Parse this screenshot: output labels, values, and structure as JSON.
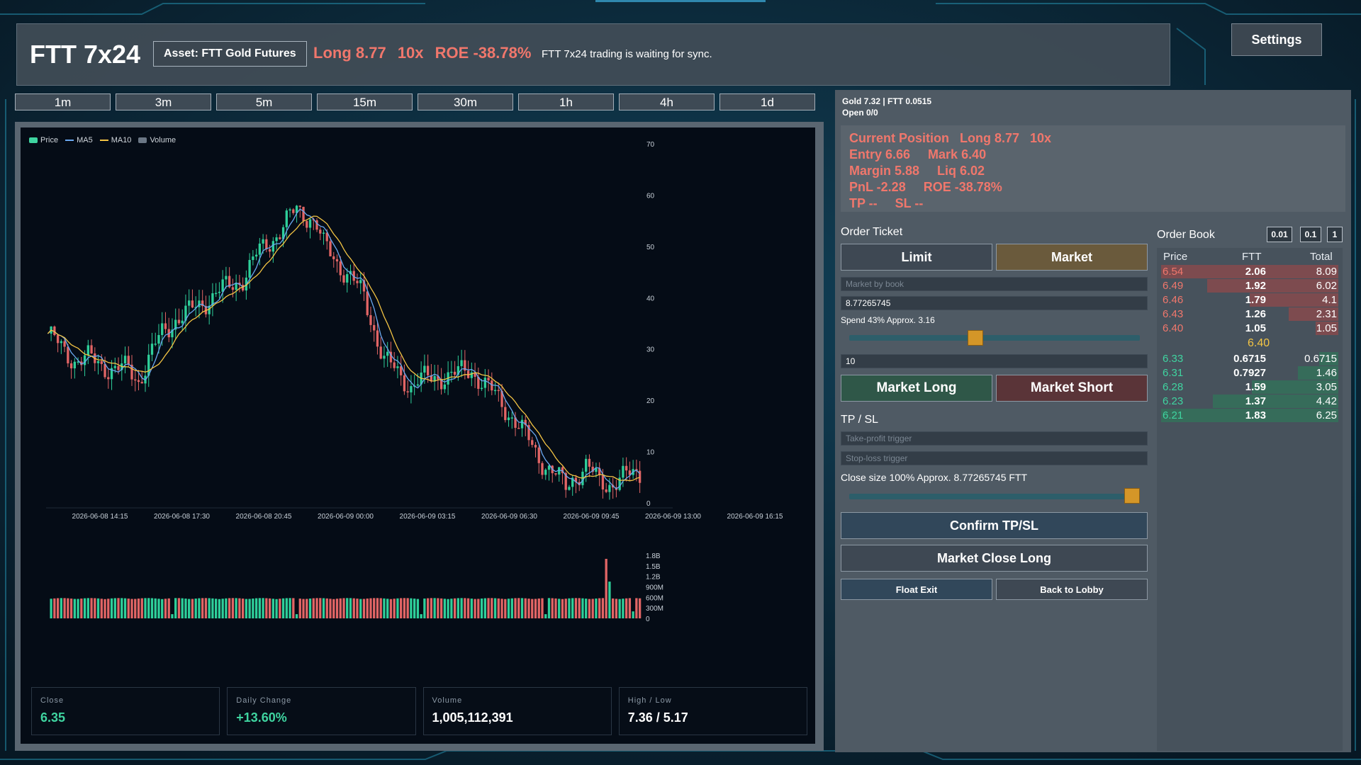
{
  "header": {
    "title": "FTT 7x24",
    "asset_label": "Asset: FTT Gold Futures",
    "pos_side": "Long 8.77",
    "pos_lev": "10x",
    "pos_roe": "ROE -38.78%",
    "sync_status": "FTT 7x24 trading is waiting for sync.",
    "settings_label": "Settings"
  },
  "timeframes": [
    "1m",
    "3m",
    "5m",
    "15m",
    "30m",
    "1h",
    "4h",
    "1d"
  ],
  "legend": [
    {
      "label": "Price",
      "color": "#3fd4a0",
      "kind": "box"
    },
    {
      "label": "MA5",
      "color": "#6aa8f0",
      "kind": "line"
    },
    {
      "label": "MA10",
      "color": "#f3c444",
      "kind": "line"
    },
    {
      "label": "Volume",
      "color": "#6b7785",
      "kind": "box"
    }
  ],
  "chart_data": {
    "type": "candlestick",
    "y_ticks": [
      0,
      10,
      20,
      30,
      40,
      50,
      60,
      70
    ],
    "ylim": [
      0,
      70
    ],
    "x_ticks": [
      "2026-06-08 14:15",
      "2026-06-08 17:30",
      "2026-06-08 20:45",
      "2026-06-09 00:00",
      "2026-06-09 03:15",
      "2026-06-09 06:30",
      "2026-06-09 09:45",
      "2026-06-09 13:00",
      "2026-06-09 16:15"
    ],
    "close_path": [
      [
        0,
        33
      ],
      [
        4,
        30
      ],
      [
        8,
        28
      ],
      [
        12,
        28
      ],
      [
        16,
        27
      ],
      [
        20,
        26
      ],
      [
        24,
        26
      ],
      [
        27,
        24
      ],
      [
        30,
        28
      ],
      [
        34,
        33
      ],
      [
        38,
        36
      ],
      [
        42,
        37
      ],
      [
        46,
        39
      ],
      [
        50,
        41
      ],
      [
        54,
        42
      ],
      [
        58,
        44
      ],
      [
        62,
        48
      ],
      [
        66,
        51
      ],
      [
        70,
        54
      ],
      [
        74,
        57
      ],
      [
        78,
        56
      ],
      [
        80,
        54
      ],
      [
        82,
        50
      ],
      [
        86,
        47
      ],
      [
        90,
        44
      ],
      [
        94,
        40
      ],
      [
        98,
        32
      ],
      [
        100,
        28
      ],
      [
        104,
        25
      ],
      [
        108,
        23
      ],
      [
        110,
        24
      ],
      [
        114,
        24
      ],
      [
        118,
        25
      ],
      [
        122,
        25
      ],
      [
        126,
        26
      ],
      [
        130,
        23
      ],
      [
        134,
        20
      ],
      [
        138,
        17
      ],
      [
        142,
        13
      ],
      [
        146,
        9
      ],
      [
        150,
        6
      ],
      [
        154,
        3
      ],
      [
        156,
        5
      ],
      [
        160,
        7
      ],
      [
        164,
        4
      ],
      [
        168,
        4
      ],
      [
        172,
        5
      ],
      [
        176,
        6
      ]
    ],
    "volume_ticks": [
      "1.8B",
      "1.5B",
      "1.2B",
      "900M",
      "600M",
      "300M",
      "0"
    ],
    "volume_max": 1.8
  },
  "stats": {
    "close_label": "Close",
    "close_value": "6.35",
    "change_label": "Daily Change",
    "change_value": "+13.60%",
    "volume_label": "Volume",
    "volume_value": "1,005,112,391",
    "hl_label": "High / Low",
    "hl_value": "7.36 / 5.17"
  },
  "account": {
    "balances": "Gold 7.32  |  FTT 0.0515",
    "open": "Open 0/0"
  },
  "position": {
    "line1": "Current Position   Long 8.77   10x",
    "line2": "Entry 6.66     Mark 6.40",
    "line3": "Margin 5.88     Liq 6.02",
    "line4": "PnL -2.28     ROE -38.78%",
    "line5": "TP --     SL --"
  },
  "ticket": {
    "title": "Order Ticket",
    "limit_label": "Limit",
    "market_label": "Market",
    "price_placeholder": "Market by book",
    "qty_value": "8.77265745",
    "spend_text": "Spend 43%  Approx. 3.16",
    "spend_fraction": 0.43,
    "leverage_value": "10",
    "long_label": "Market Long",
    "short_label": "Market Short",
    "tpsl_title": "TP / SL",
    "tp_placeholder": "Take-profit trigger",
    "sl_placeholder": "Stop-loss trigger",
    "close_size_text": "Close size 100%  Approx. 8.77265745 FTT",
    "close_fraction": 1.0,
    "confirm_label": "Confirm TP/SL",
    "close_long_label": "Market Close Long",
    "float_exit_label": "Float Exit",
    "lobby_label": "Back to Lobby"
  },
  "orderbook": {
    "title": "Order Book",
    "steps": [
      "0.01",
      "0.1",
      "1"
    ],
    "col_price": "Price",
    "col_qty": "FTT",
    "col_total": "Total",
    "asks": [
      {
        "price": "6.54",
        "qty": "2.06",
        "total": "8.09",
        "depth": 1.0
      },
      {
        "price": "6.49",
        "qty": "1.92",
        "total": "6.02",
        "depth": 0.74
      },
      {
        "price": "6.46",
        "qty": "1.79",
        "total": "4.1",
        "depth": 0.5
      },
      {
        "price": "6.43",
        "qty": "1.26",
        "total": "2.31",
        "depth": 0.28
      },
      {
        "price": "6.40",
        "qty": "1.05",
        "total": "1.05",
        "depth": 0.13
      }
    ],
    "mid": "6.40",
    "bids": [
      {
        "price": "6.33",
        "qty": "0.6715",
        "total": "0.6715",
        "depth": 0.11
      },
      {
        "price": "6.31",
        "qty": "0.7927",
        "total": "1.46",
        "depth": 0.23
      },
      {
        "price": "6.28",
        "qty": "1.59",
        "total": "3.05",
        "depth": 0.49
      },
      {
        "price": "6.23",
        "qty": "1.37",
        "total": "4.42",
        "depth": 0.71
      },
      {
        "price": "6.21",
        "qty": "1.83",
        "total": "6.25",
        "depth": 1.0
      }
    ],
    "ask_color": "#f0776c",
    "bid_color": "#3fd4a0"
  }
}
